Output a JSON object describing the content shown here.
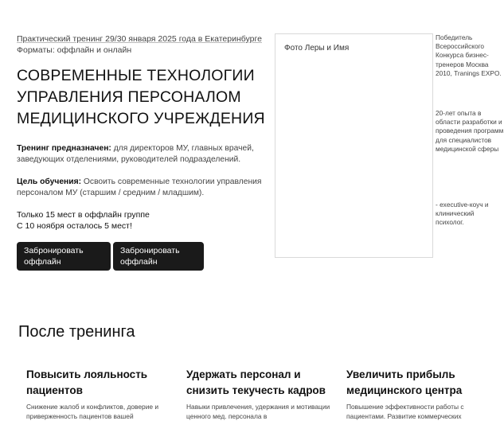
{
  "hero": {
    "eyebrow_line1": "Практический тренинг 29/30 января 2025 года в Екатеринбурге",
    "eyebrow_line2": "Форматы: оффлайн и онлайн",
    "title_lines": [
      "СОВРЕМЕННЫЕ ТЕХНОЛОГИИ",
      "УПРАВЛЕНИЯ ПЕРСОНАЛОМ",
      "МЕДИЦИНСКОГО УЧРЕЖДЕНИЯ"
    ],
    "audience_label": "Тренинг предназначен:",
    "audience_text": " для директоров МУ, главных врачей, заведующих отделениями, руководителей подразделений.",
    "goal_label": "Цель обучения:",
    "goal_text": " Освоить современные технологии управления персоналом МУ (старшим / средним / младшим).",
    "seats_line1": "Только 15 мест в оффлайн группе",
    "seats_line2": "С 10 ноября осталось 5 мест!",
    "buttons": [
      {
        "line1": "Забронировать",
        "line2": "оффлайн"
      },
      {
        "line1": "Забронировать",
        "line2": "оффлайн"
      }
    ]
  },
  "trainer": {
    "photo_label": "Фото Леры и Имя",
    "facts": [
      "Победитель Всероссийского Конкурса бизнес-тренеров Москва 2010, Tranings EXPO.",
      "20-лет опыта в области разработки и проведения программ для специалистов медицинской сферы",
      "- executive-коуч и клинический психолог."
    ]
  },
  "after": {
    "heading": "После тренинга",
    "items": [
      {
        "title": "Повысить лояльность пациентов",
        "text": "Снижение жалоб и конфликтов, доверие и приверженность пациентов вашей"
      },
      {
        "title": "Удержать персонал и снизить текучесть кадров",
        "text": "Навыки привлечения, удержания и мотивации ценного мед. персонала в"
      },
      {
        "title": "Увеличить прибыль медицинского центра",
        "text": "Повышение эффективности работы с пациентами. Развитие коммерческих"
      }
    ]
  }
}
